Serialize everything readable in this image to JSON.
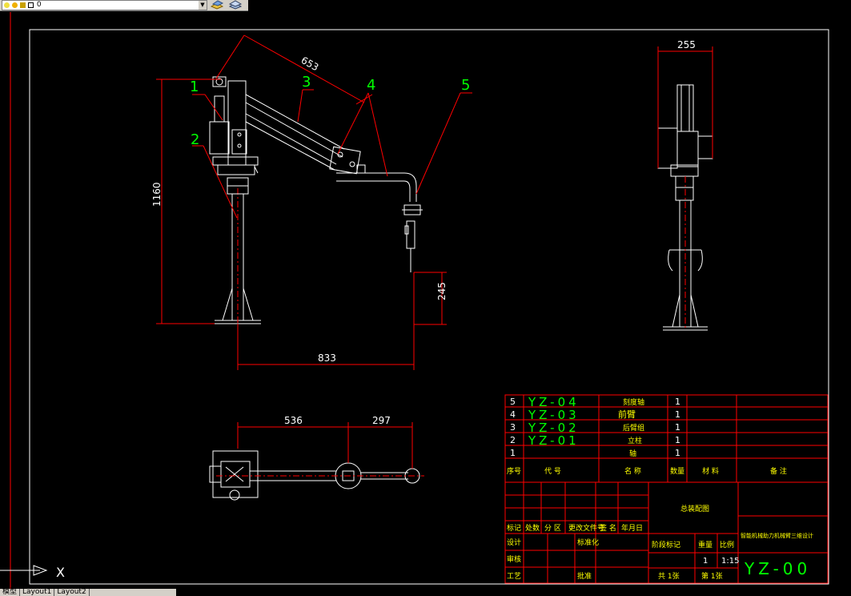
{
  "toolbar": {
    "layer_value": "0",
    "layer_icons": [
      "bulb-icon",
      "sun-icon",
      "lock-icon",
      "color-swatch-icon"
    ],
    "buttons": [
      "layer-previous-icon",
      "layer-states-icon"
    ]
  },
  "tabs": [
    "模型",
    "Layout1",
    "Layout2"
  ],
  "ucs_label": "X",
  "colors": {
    "red": "#ff0000",
    "green": "#00ff00",
    "white": "#ffffff",
    "yellow": "#ffff00"
  },
  "dimensions": {
    "arm_length": "653",
    "column_height": "1160",
    "reach": "833",
    "tool_height": "245",
    "side_width": "255",
    "top_left": "536",
    "top_right": "297"
  },
  "balloons": [
    "1",
    "2",
    "3",
    "4",
    "5"
  ],
  "parts": [
    {
      "no": "5",
      "code": "YZ-04",
      "name": "刻度轴",
      "qty": "1"
    },
    {
      "no": "4",
      "code": "YZ-03",
      "name": "前臂",
      "qty": "1"
    },
    {
      "no": "3",
      "code": "YZ-02",
      "name": "后臂组",
      "qty": "1"
    },
    {
      "no": "2",
      "code": "YZ-01",
      "name": "立柱",
      "qty": "1"
    },
    {
      "no": "1",
      "code": "",
      "name": "轴",
      "qty": "1"
    }
  ],
  "parts_header": {
    "no": "序号",
    "code": "代 号",
    "name": "名 称",
    "qty": "数量",
    "material": "材 料",
    "note": "备 注"
  },
  "title_block": {
    "assembly": "总装配图",
    "title": "智能机械助力机械臂三维设计",
    "drawing_no": "YZ-00",
    "row_labels": [
      "标记",
      "处数",
      "分 区",
      "更改文件号",
      "签 名",
      "年月日"
    ],
    "side_labels": [
      "设计",
      "审核",
      "工艺"
    ],
    "std_label": "标准化",
    "approve_label": "批准",
    "stage_label": "阶段标记",
    "weight_label": "重量",
    "scale_label": "比例",
    "weight": "1",
    "scale": "1:15",
    "sheets_total": "共 1张",
    "sheet_no": "第 1张"
  }
}
